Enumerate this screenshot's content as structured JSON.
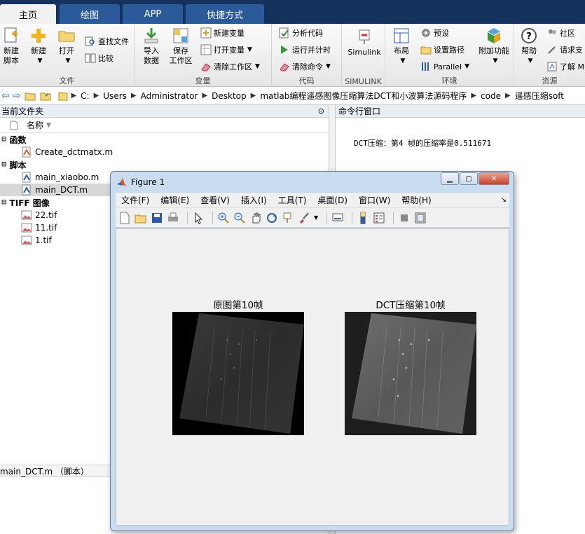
{
  "tabs": [
    "主页",
    "绘图",
    "APP",
    "快捷方式"
  ],
  "ribbon": {
    "file_group": {
      "label": "文件",
      "new_script": "新建\n脚本",
      "new": "新建",
      "open": "打开",
      "find_files": "查找文件",
      "compare": "比较"
    },
    "variable_group": {
      "label": "变量",
      "import": "导入\n数据",
      "save_workspace": "保存\n工作区",
      "new_variable": "新建变量",
      "open_variable": "打开变量",
      "clear_workspace": "清除工作区"
    },
    "code_group": {
      "label": "代码",
      "analyze": "分析代码",
      "run_and_time": "运行并计时",
      "clear_commands": "清除命令"
    },
    "simulink_group": {
      "label": "SIMULINK",
      "simulink": "Simulink"
    },
    "env_group": {
      "label": "环境",
      "layout": "布局",
      "preferences": "预设",
      "set_path": "设置路径",
      "parallel": "Parallel",
      "addons": "附加功能"
    },
    "resources_group": {
      "label": "资源",
      "help": "帮助",
      "community": "社区",
      "request_support": "请求支",
      "learn": "了解 M"
    }
  },
  "address": {
    "path": [
      "C:",
      "Users",
      "Administrator",
      "Desktop",
      "matlab编程遥感图像压缩算法DCT和小波算法源码程序",
      "code",
      "遥感压缩soft"
    ]
  },
  "file_panel": {
    "title": "当前文件夹",
    "column": "名称",
    "groups": [
      {
        "name": "函数",
        "items": [
          "Create_dctmatx.m"
        ]
      },
      {
        "name": "脚本",
        "items": [
          "main_xiaobo.m",
          "main_DCT.m"
        ]
      },
      {
        "name": "TIFF 图像",
        "items": [
          "22.tif",
          "11.tif",
          "1.tif"
        ]
      }
    ],
    "selected": "main_DCT.m",
    "details": "main_DCT.m （脚本）"
  },
  "command_window": {
    "title": "命令行窗口",
    "output": "DCT压缩：第4 帧的压缩率是0.511671"
  },
  "figure": {
    "title": "Figure 1",
    "menus": [
      "文件(F)",
      "编辑(E)",
      "查看(V)",
      "插入(I)",
      "工具(T)",
      "桌面(D)",
      "窗口(W)",
      "帮助(H)"
    ],
    "axes": [
      {
        "title": "原图第10帧"
      },
      {
        "title": "DCT压缩第10帧"
      }
    ]
  },
  "colors": {
    "tabstrip": "#14325c",
    "tab": "#2a5a9a",
    "figure_frame": "#c9dcf0"
  }
}
